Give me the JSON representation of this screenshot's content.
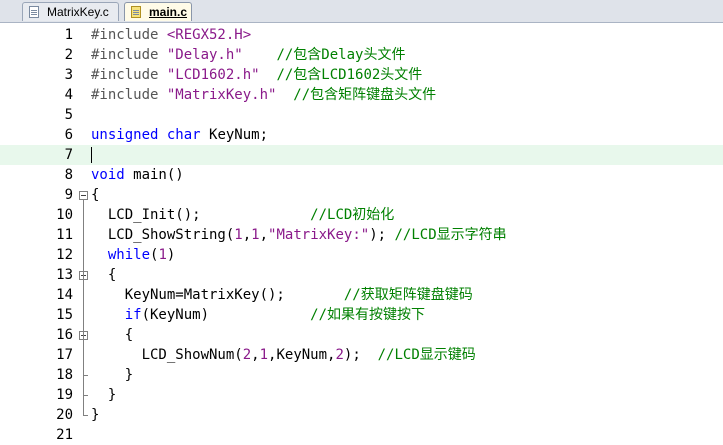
{
  "tabs": [
    {
      "label": "MatrixKey.c",
      "active": false
    },
    {
      "label": "main.c",
      "active": true
    }
  ],
  "editor": {
    "current_line": 7,
    "lines": [
      {
        "n": "1",
        "tokens": [
          [
            "pp",
            "#include "
          ],
          [
            "str",
            "<REGX52.H>"
          ]
        ]
      },
      {
        "n": "2",
        "tokens": [
          [
            "pp",
            "#include "
          ],
          [
            "str",
            "\"Delay.h\""
          ],
          [
            "txt",
            "    "
          ],
          [
            "com",
            "//包含Delay头文件"
          ]
        ]
      },
      {
        "n": "3",
        "tokens": [
          [
            "pp",
            "#include "
          ],
          [
            "str",
            "\"LCD1602.h\""
          ],
          [
            "txt",
            "  "
          ],
          [
            "com",
            "//包含LCD1602头文件"
          ]
        ]
      },
      {
        "n": "4",
        "tokens": [
          [
            "pp",
            "#include "
          ],
          [
            "str",
            "\"MatrixKey.h\""
          ],
          [
            "txt",
            "  "
          ],
          [
            "com",
            "//包含矩阵键盘头文件"
          ]
        ]
      },
      {
        "n": "5",
        "tokens": []
      },
      {
        "n": "6",
        "tokens": [
          [
            "kw",
            "unsigned"
          ],
          [
            "txt",
            " "
          ],
          [
            "kw",
            "char"
          ],
          [
            "txt",
            " KeyNum;"
          ]
        ]
      },
      {
        "n": "7",
        "tokens": []
      },
      {
        "n": "8",
        "tokens": [
          [
            "kw",
            "void"
          ],
          [
            "txt",
            " main()"
          ]
        ]
      },
      {
        "n": "9",
        "tokens": [
          [
            "txt",
            "{"
          ]
        ]
      },
      {
        "n": "10",
        "tokens": [
          [
            "txt",
            "  LCD_Init();             "
          ],
          [
            "com",
            "//LCD初始化"
          ]
        ]
      },
      {
        "n": "11",
        "tokens": [
          [
            "txt",
            "  LCD_ShowString("
          ],
          [
            "num",
            "1"
          ],
          [
            "txt",
            ","
          ],
          [
            "num",
            "1"
          ],
          [
            "txt",
            ","
          ],
          [
            "str",
            "\"MatrixKey:\""
          ],
          [
            "txt",
            "); "
          ],
          [
            "com",
            "//LCD显示字符串"
          ]
        ]
      },
      {
        "n": "12",
        "tokens": [
          [
            "txt",
            "  "
          ],
          [
            "kw",
            "while"
          ],
          [
            "txt",
            "("
          ],
          [
            "num",
            "1"
          ],
          [
            "txt",
            ")"
          ]
        ]
      },
      {
        "n": "13",
        "tokens": [
          [
            "txt",
            "  {"
          ]
        ]
      },
      {
        "n": "14",
        "tokens": [
          [
            "txt",
            "    KeyNum=MatrixKey();       "
          ],
          [
            "com",
            "//获取矩阵键盘键码"
          ]
        ]
      },
      {
        "n": "15",
        "tokens": [
          [
            "txt",
            "    "
          ],
          [
            "kw",
            "if"
          ],
          [
            "txt",
            "(KeyNum)            "
          ],
          [
            "com",
            "//如果有按键按下"
          ]
        ]
      },
      {
        "n": "16",
        "tokens": [
          [
            "txt",
            "    {"
          ]
        ]
      },
      {
        "n": "17",
        "tokens": [
          [
            "txt",
            "      LCD_ShowNum("
          ],
          [
            "num",
            "2"
          ],
          [
            "txt",
            ","
          ],
          [
            "num",
            "1"
          ],
          [
            "txt",
            ",KeyNum,"
          ],
          [
            "num",
            "2"
          ],
          [
            "txt",
            ");  "
          ],
          [
            "com",
            "//LCD显示键码"
          ]
        ]
      },
      {
        "n": "18",
        "tokens": [
          [
            "txt",
            "    }"
          ]
        ]
      },
      {
        "n": "19",
        "tokens": [
          [
            "txt",
            "  }"
          ]
        ]
      },
      {
        "n": "20",
        "tokens": [
          [
            "txt",
            "}"
          ]
        ]
      },
      {
        "n": "21",
        "tokens": []
      }
    ]
  }
}
